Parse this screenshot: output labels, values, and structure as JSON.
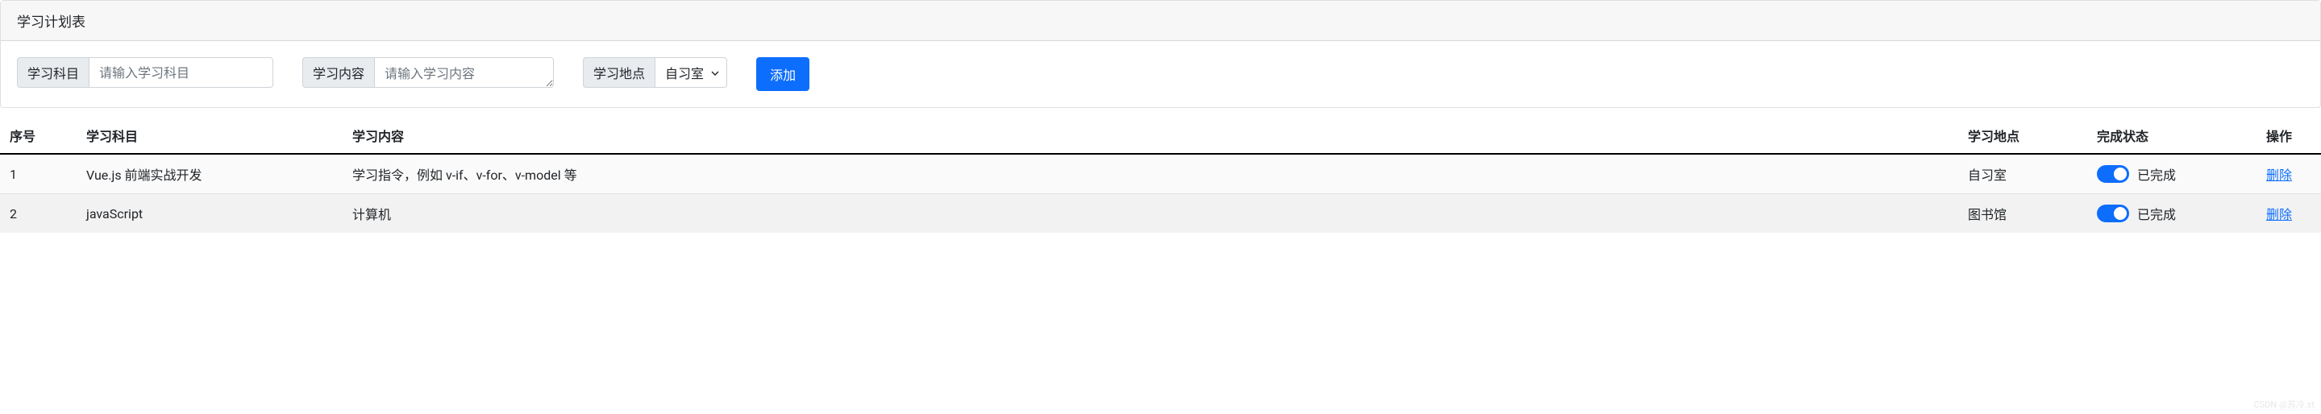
{
  "header": {
    "title": "学习计划表"
  },
  "form": {
    "subject": {
      "label": "学习科目",
      "placeholder": "请输入学习科目",
      "value": ""
    },
    "content": {
      "label": "学习内容",
      "placeholder": "请输入学习内容",
      "value": ""
    },
    "location": {
      "label": "学习地点",
      "selected": "自习室"
    },
    "submit_label": "添加"
  },
  "table": {
    "headers": {
      "index": "序号",
      "subject": "学习科目",
      "content": "学习内容",
      "location": "学习地点",
      "status": "完成状态",
      "action": "操作"
    },
    "rows": [
      {
        "index": "1",
        "subject": "Vue.js 前端实战开发",
        "content": "学习指令，例如 v-if、v-for、v-model 等",
        "location": "自习室",
        "status_on": true,
        "status_label": "已完成",
        "action_label": "删除"
      },
      {
        "index": "2",
        "subject": "javaScript",
        "content": "计算机",
        "location": "图书馆",
        "status_on": true,
        "status_label": "已完成",
        "action_label": "删除"
      }
    ]
  },
  "watermark": "CSDN @苏冷.st"
}
